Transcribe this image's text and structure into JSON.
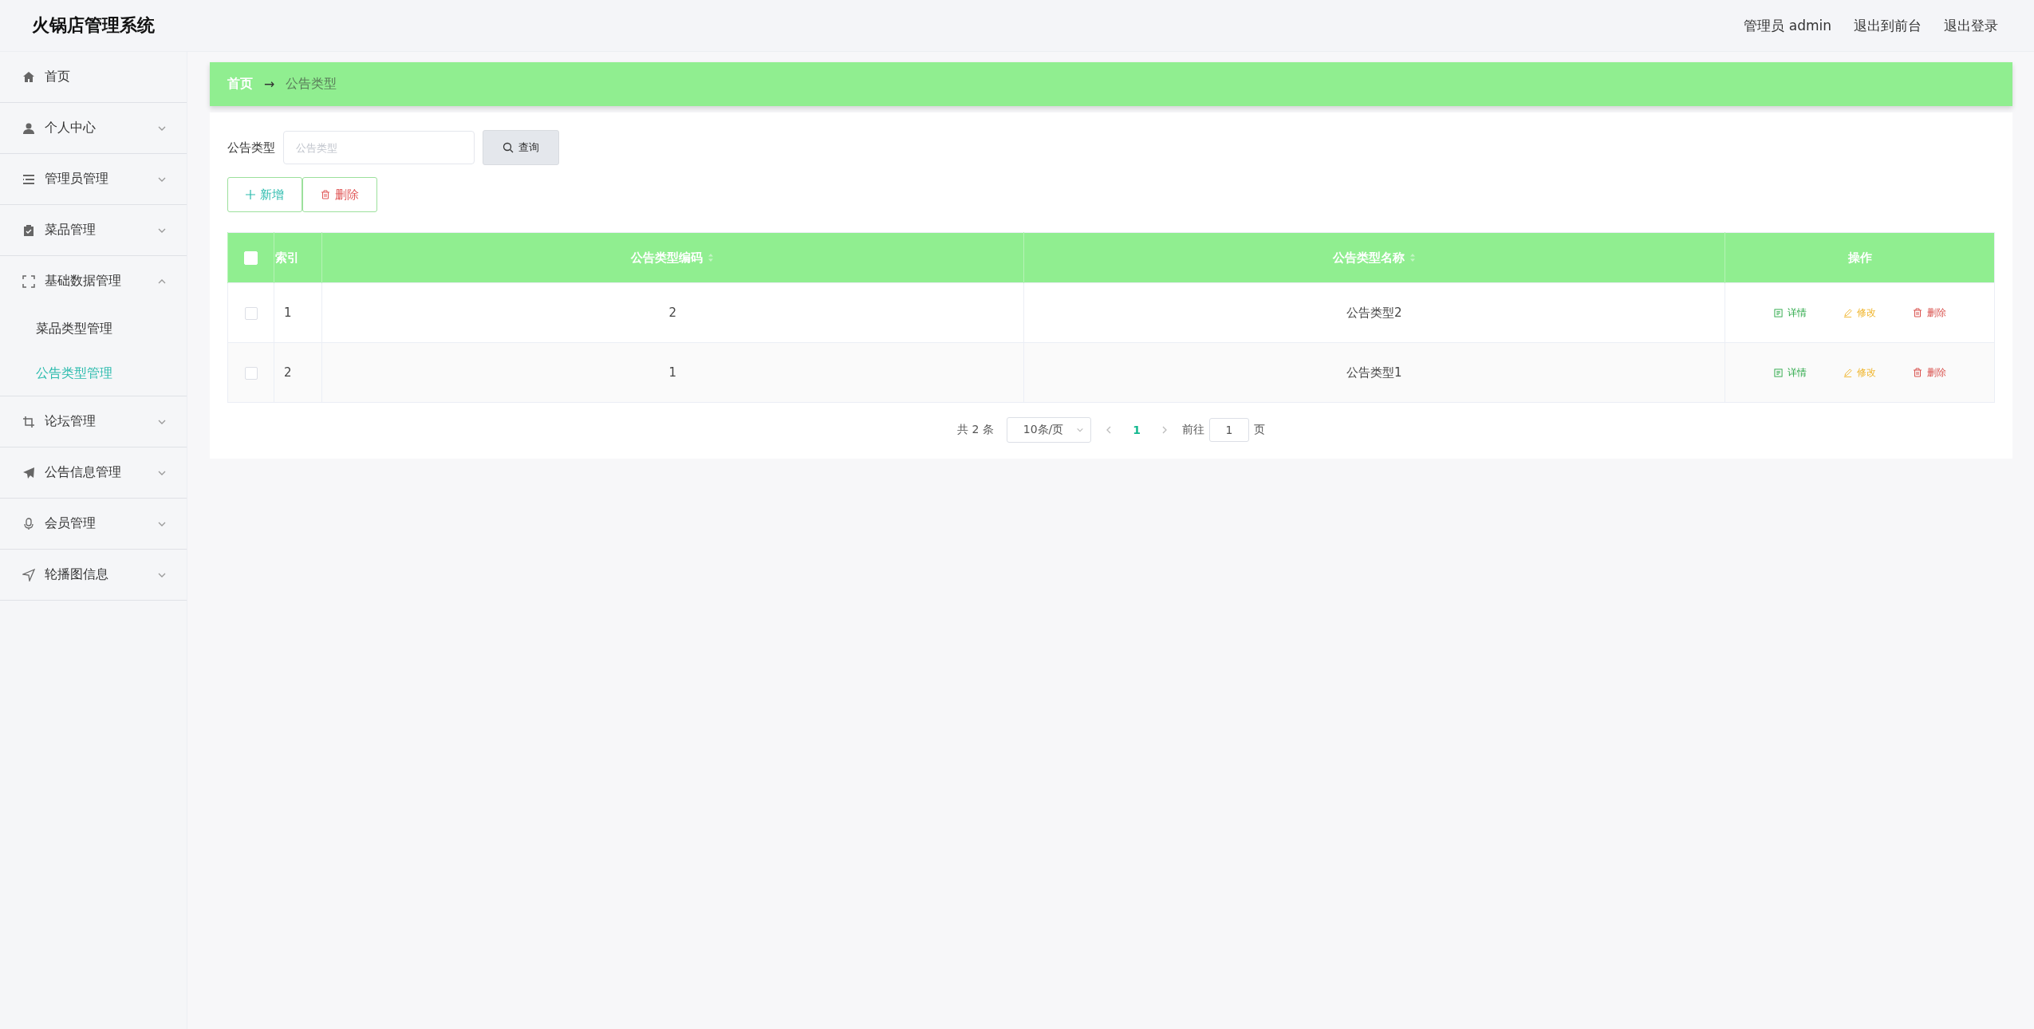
{
  "app": {
    "title": "火锅店管理系统",
    "links": [
      "管理员 admin",
      "退出到前台",
      "退出登录"
    ]
  },
  "sidebar": {
    "items": [
      {
        "kind": "link",
        "label": "首页"
      },
      {
        "kind": "menu",
        "label": "个人中心",
        "expanded": false
      },
      {
        "kind": "menu",
        "label": "管理员管理",
        "expanded": false
      },
      {
        "kind": "menu",
        "label": "菜品管理",
        "expanded": false
      },
      {
        "kind": "menu",
        "label": "基础数据管理",
        "expanded": true,
        "children": [
          {
            "label": "菜品类型管理",
            "selected": false
          },
          {
            "label": "公告类型管理",
            "selected": true
          }
        ]
      },
      {
        "kind": "menu",
        "label": "论坛管理",
        "expanded": false
      },
      {
        "kind": "menu",
        "label": "公告信息管理",
        "expanded": false
      },
      {
        "kind": "menu",
        "label": "会员管理",
        "expanded": false
      },
      {
        "kind": "menu",
        "label": "轮播图信息",
        "expanded": false
      }
    ]
  },
  "breadcrumb": {
    "items": [
      "首页",
      "公告类型"
    ],
    "separator": "→"
  },
  "search": {
    "label": "公告类型",
    "placeholder": "公告类型",
    "button": "查询"
  },
  "actions": [
    {
      "kind": "add",
      "label": "新增"
    },
    {
      "kind": "delete",
      "label": "删除"
    }
  ],
  "table": {
    "select_all": {
      "checked": false
    },
    "columns": [
      {
        "label": "索引",
        "sortable": false
      },
      {
        "label": "公告类型编码",
        "sortable": true
      },
      {
        "label": "公告类型名称",
        "sortable": true
      },
      {
        "label": "操作",
        "sortable": false
      }
    ],
    "rows": [
      {
        "checked": false,
        "index": "1",
        "code": "2",
        "name": "公告类型2",
        "actions": [
          {
            "kind": "detail",
            "label": "详情"
          },
          {
            "kind": "edit",
            "label": "修改"
          },
          {
            "kind": "delete",
            "label": "删除"
          }
        ]
      },
      {
        "checked": false,
        "index": "2",
        "code": "1",
        "name": "公告类型1",
        "actions": [
          {
            "kind": "detail",
            "label": "详情"
          },
          {
            "kind": "edit",
            "label": "修改"
          },
          {
            "kind": "delete",
            "label": "删除"
          }
        ]
      }
    ]
  },
  "pagination": {
    "total": "共 2 条",
    "page_size": "10条/页",
    "pages": [
      {
        "label": "1",
        "selected": true
      }
    ],
    "goto_label": "前往",
    "goto_value": "1",
    "page_suffix": "页"
  }
}
